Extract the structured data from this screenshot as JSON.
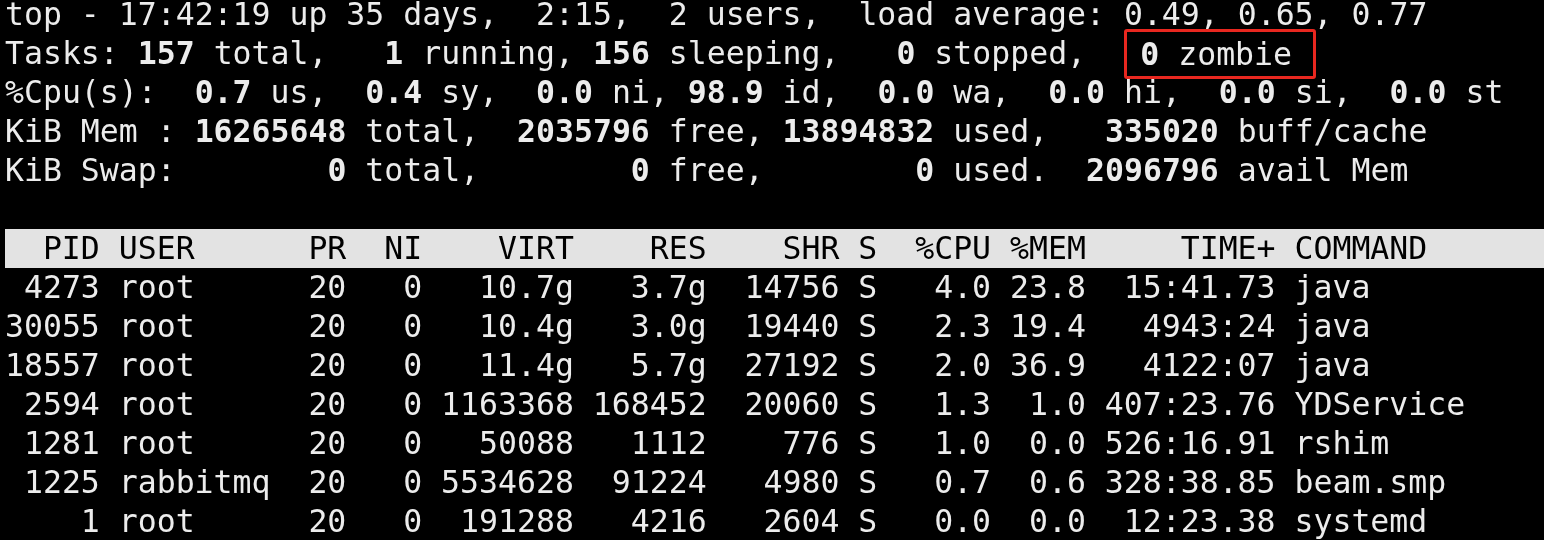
{
  "summary": [
    "top - 17:42:19 up 35 days,  2:15,  2 users,  load average: 0.49, 0.65, 0.77",
    {
      "text": "Tasks: **157** total,   **1** running, **156** sleeping,   **0** stopped,  ",
      "highlighted": "**0** zombie"
    },
    "%Cpu(s):  **0.7** us,  **0.4** sy,  **0.0** ni, **98.9** id,  **0.0** wa,  **0.0** hi,  **0.0** si,  **0.0** st",
    "KiB Mem : **16265648** total,  **2035796** free, **13894832** used,   **335020** buff/cache",
    "KiB Swap:        **0** total,        **0** free,        **0** used.  **2096796** avail Mem"
  ],
  "table": {
    "columns": [
      "PID",
      "USER",
      "PR",
      "NI",
      "VIRT",
      "RES",
      "SHR",
      "S",
      "%CPU",
      "%MEM",
      "TIME+",
      "COMMAND"
    ],
    "rows": [
      [
        "4273",
        "root",
        "20",
        "0",
        "10.7g",
        "3.7g",
        "14756",
        "S",
        "4.0",
        "23.8",
        "15:41.73",
        "java"
      ],
      [
        "30055",
        "root",
        "20",
        "0",
        "10.4g",
        "3.0g",
        "19440",
        "S",
        "2.3",
        "19.4",
        "4943:24",
        "java"
      ],
      [
        "18557",
        "root",
        "20",
        "0",
        "11.4g",
        "5.7g",
        "27192",
        "S",
        "2.0",
        "36.9",
        "4122:07",
        "java"
      ],
      [
        "2594",
        "root",
        "20",
        "0",
        "1163368",
        "168452",
        "20060",
        "S",
        "1.3",
        "1.0",
        "407:23.76",
        "YDService"
      ],
      [
        "1281",
        "root",
        "20",
        "0",
        "50088",
        "1112",
        "776",
        "S",
        "1.0",
        "0.0",
        "526:16.91",
        "rshim"
      ],
      [
        "1225",
        "rabbitmq",
        "20",
        "0",
        "5534628",
        "91224",
        "4980",
        "S",
        "0.7",
        "0.6",
        "328:38.85",
        "beam.smp"
      ],
      [
        "1",
        "root",
        "20",
        "0",
        "191288",
        "4216",
        "2604",
        "S",
        "0.0",
        "0.0",
        "12:23.38",
        "systemd"
      ]
    ]
  }
}
